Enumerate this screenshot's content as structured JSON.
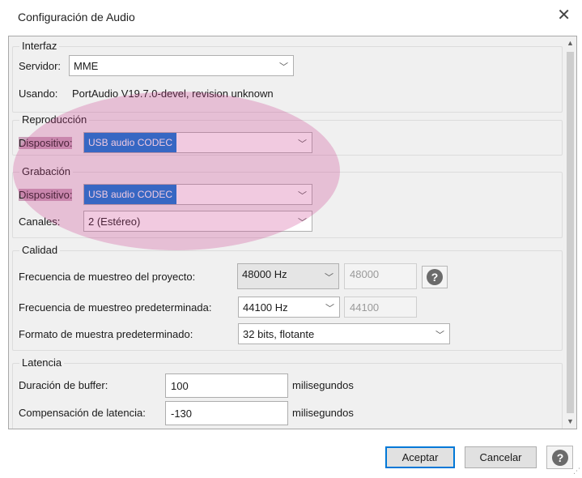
{
  "window": {
    "title": "Configuración de Audio",
    "close_glyph": "✕"
  },
  "interface": {
    "legend": "Interfaz",
    "host_label": "Servidor:",
    "host_value": "MME",
    "using_label": "Usando:",
    "using_value": "PortAudio V19.7.0-devel, revision unknown"
  },
  "playback": {
    "legend": "Reproducción",
    "device_label": "Dispositivo:",
    "device_value": "USB audio CODEC"
  },
  "recording": {
    "legend": "Grabación",
    "device_label": "Dispositivo:",
    "device_value": "USB audio CODEC",
    "channels_label": "Canales:",
    "channels_value": "2 (Estéreo)"
  },
  "quality": {
    "legend": "Calidad",
    "project_rate_label": "Frecuencia de muestreo del proyecto:",
    "project_rate_value": "48000 Hz",
    "project_rate_custom": "48000",
    "default_rate_label": "Frecuencia de muestreo predeterminada:",
    "default_rate_value": "44100 Hz",
    "default_rate_custom": "44100",
    "format_label": "Formato de muestra predeterminado:",
    "format_value": "32 bits, flotante"
  },
  "latency": {
    "legend": "Latencia",
    "buffer_label": "Duración de buffer:",
    "buffer_value": "100",
    "buffer_unit": "milisegundos",
    "comp_label": "Compensación de latencia:",
    "comp_value": "-130",
    "comp_unit": "milisegundos"
  },
  "footer": {
    "ok_label": "Aceptar",
    "cancel_label": "Cancelar"
  },
  "icons": {
    "help": "?",
    "chevron": "﹀",
    "scroll_up": "▲",
    "scroll_down": "▼",
    "grip": "⋰"
  },
  "colors": {
    "annotation": "#cc3c8c",
    "selection": "#0078d7"
  }
}
